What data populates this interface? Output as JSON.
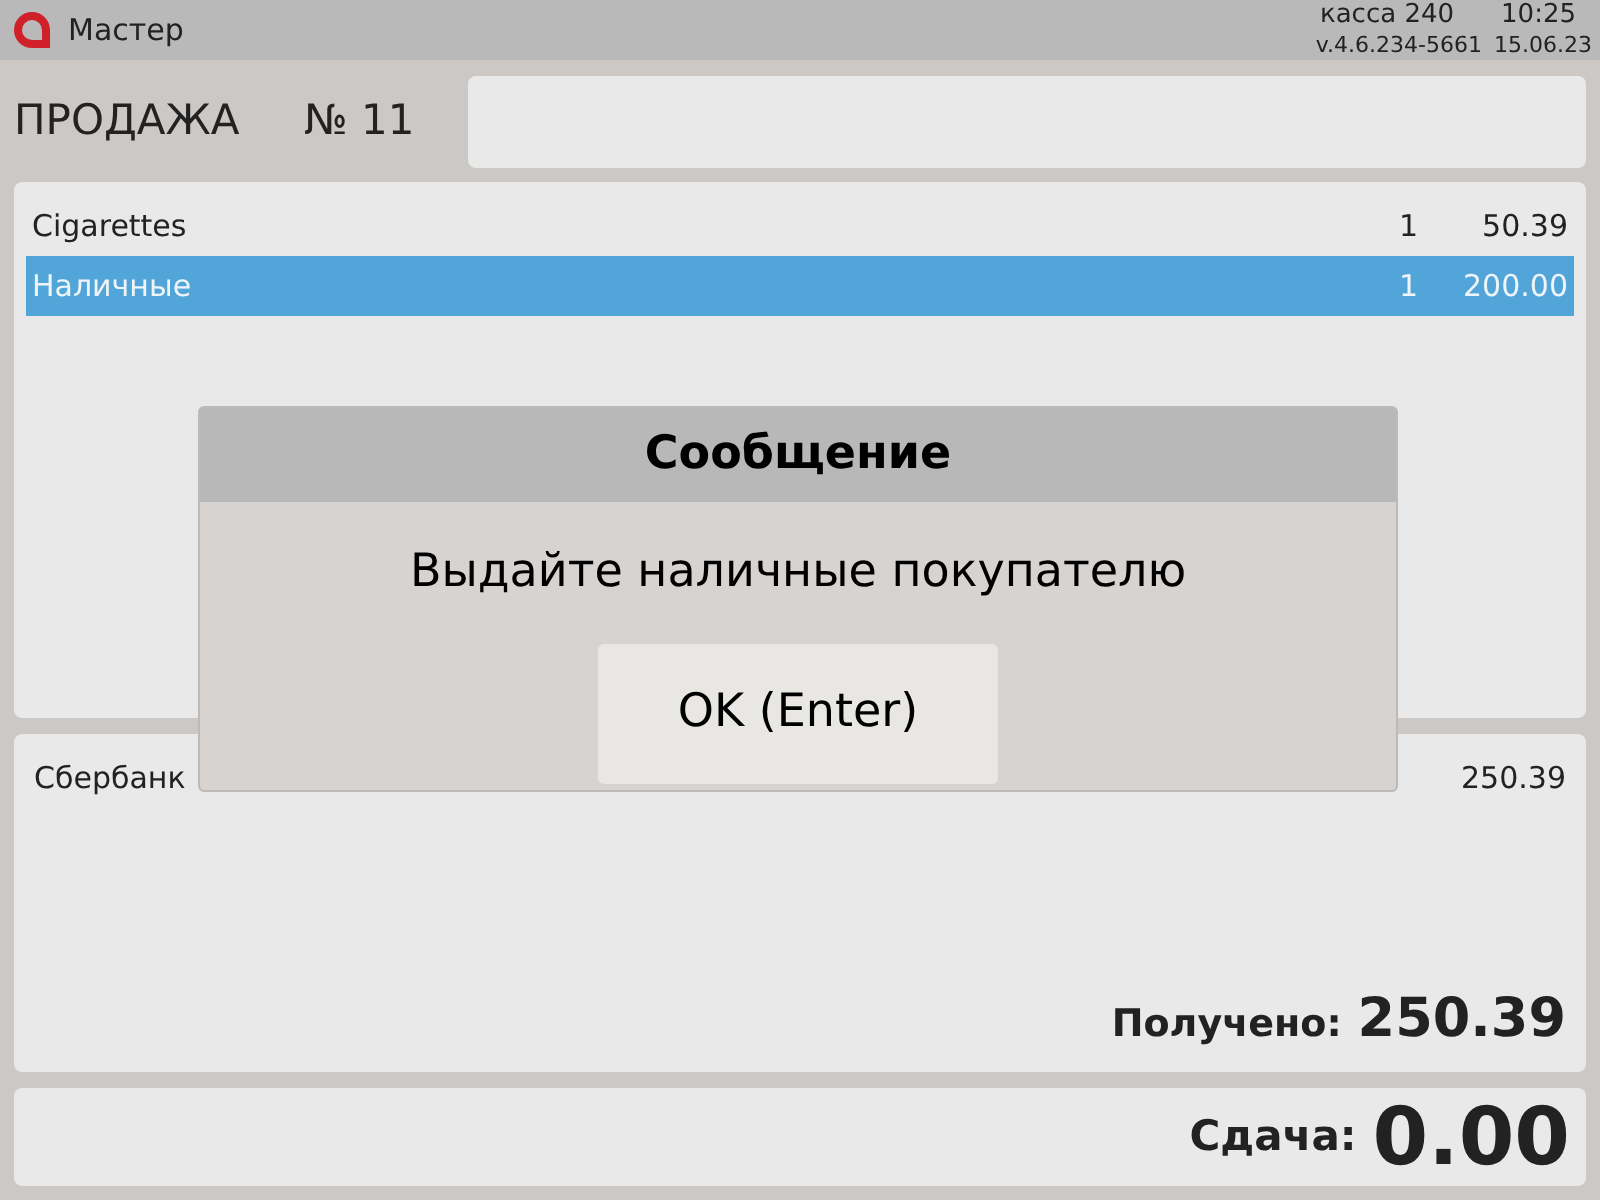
{
  "top_bar": {
    "title": "Мастер",
    "register": "касса 240",
    "time": "10:25",
    "version": "v.4.6.234-5661",
    "date": "15.06.23"
  },
  "sale": {
    "title": "ПРОДАЖА",
    "number": "№ 11"
  },
  "items": [
    {
      "name": "Cigarettes",
      "qty": "1",
      "amount": "50.39",
      "selected": false
    },
    {
      "name": "Наличные",
      "qty": "1",
      "amount": "200.00",
      "selected": true
    }
  ],
  "payments": [
    {
      "name": "Сбербанк",
      "amount": "250.39"
    }
  ],
  "received": {
    "label": "Получено:",
    "value": "250.39"
  },
  "change": {
    "label": "Сдача:",
    "value": "0.00"
  },
  "dialog": {
    "title": "Сообщение",
    "message": "Выдайте наличные покупателю",
    "button": "OK (Enter)"
  }
}
